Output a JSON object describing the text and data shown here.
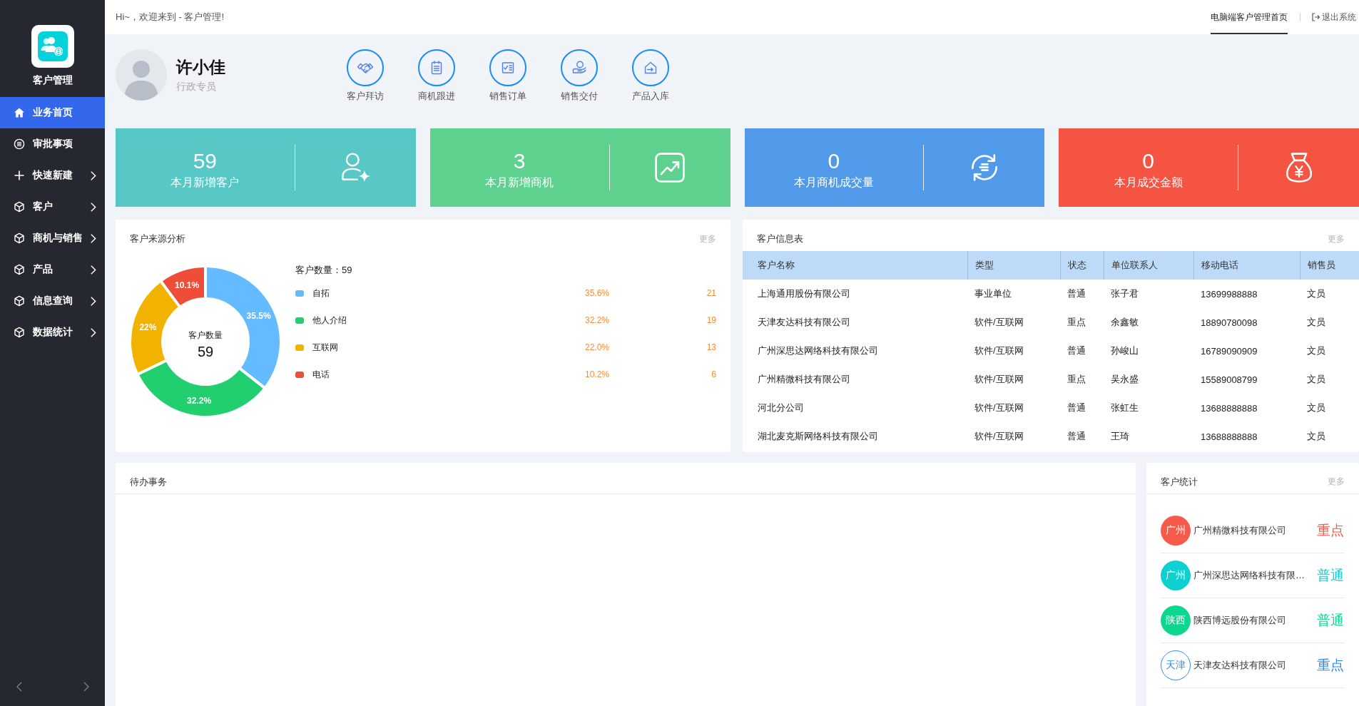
{
  "sidebar": {
    "app_name": "客户管理",
    "menu": [
      {
        "label": "业务首页",
        "kind": "link",
        "selected": true
      },
      {
        "label": "审批事项",
        "kind": "link",
        "selected": false
      },
      {
        "label": "快速新建",
        "kind": "submenu",
        "selected": false
      },
      {
        "label": "客户",
        "kind": "submenu",
        "selected": false
      },
      {
        "label": "商机与销售",
        "kind": "submenu",
        "selected": false
      },
      {
        "label": "产品",
        "kind": "submenu",
        "selected": false
      },
      {
        "label": "信息查询",
        "kind": "submenu",
        "selected": false
      },
      {
        "label": "数据统计",
        "kind": "submenu",
        "selected": false
      }
    ]
  },
  "topbar": {
    "greeting": "Hi~，欢迎来到 - 客户管理!",
    "tabs": [
      {
        "label": "电脑端客户管理首页",
        "selected": true
      }
    ],
    "logout": "退出系统"
  },
  "profile": {
    "name": "许小佳",
    "role": "行政专员"
  },
  "quick_actions": [
    "客户拜访",
    "商机跟进",
    "销售订单",
    "销售交付",
    "产品入库"
  ],
  "stats": [
    {
      "value": "59",
      "label": "本月新增客户",
      "color": "#57c8c5"
    },
    {
      "value": "3",
      "label": "本月新增商机",
      "color": "#5fd18f"
    },
    {
      "value": "0",
      "label": "本月商机成交量",
      "color": "#5199e9"
    },
    {
      "value": "0",
      "label": "本月成交金额",
      "color": "#f65443"
    }
  ],
  "source_panel": {
    "title": "客户来源分析",
    "more": "更多",
    "center_label": "客户数量",
    "center_value": "59",
    "legend_title": "客户数量：59",
    "legend": [
      {
        "color": "#65bbff",
        "percent": "35.6%",
        "count": "21"
      },
      {
        "color": "#22cf6e",
        "percent": "32.2%",
        "count": "19"
      },
      {
        "color": "#f2b300",
        "percent": "22.0%",
        "count": "13"
      },
      {
        "color": "#ee4d38",
        "percent": "10.2%",
        "count": "6"
      }
    ],
    "chart_data": {
      "type": "donut",
      "categories": [
        "自拓",
        "他人介绍",
        "互联网",
        "电话"
      ],
      "values": [
        35.5,
        32.2,
        22,
        10.1
      ],
      "value_labels": [
        "35.5%",
        "32.2%",
        "22%",
        "10.1%"
      ]
    }
  },
  "customer_table": {
    "title": "客户信息表",
    "more": "更多",
    "columns": [
      "客户名称",
      "类型",
      "状态",
      "单位联系人",
      "移动电话",
      "销售员"
    ],
    "rows": [
      [
        "上海通用股份有限公司",
        "事业单位",
        "普通",
        "张子君",
        "13699988888",
        "文员"
      ],
      [
        "天津友达科技有限公司",
        "软件/互联网",
        "重点",
        "余鑫敏",
        "18890780098",
        "文员"
      ],
      [
        "广州深思达网络科技有限公司",
        "软件/互联网",
        "普通",
        "孙峻山",
        "16789090909",
        "文员"
      ],
      [
        "广州精微科技有限公司",
        "软件/互联网",
        "重点",
        "吴永盛",
        "15589008799",
        "文员"
      ],
      [
        "河北分公司",
        "软件/互联网",
        "普通",
        "张虹生",
        "13688888888",
        "文员"
      ],
      [
        "湖北麦克斯网络科技有限公司",
        "软件/互联网",
        "普通",
        "王琦",
        "13688888888",
        "文员"
      ]
    ]
  },
  "todo_panel": {
    "title": "待办事务"
  },
  "customer_stats": {
    "title": "客户统计",
    "more": "更多",
    "items": [
      {
        "badge": "广州",
        "kind": "filled",
        "color": "#f65a4a",
        "name": "广州精微科技有限公司",
        "status": "重点"
      },
      {
        "badge": "广州",
        "kind": "filled",
        "color": "#0fd0d0",
        "name": "广州深思达网络科技有限…",
        "status": "普通"
      },
      {
        "badge": "陕西",
        "kind": "filled",
        "color": "#0dd68f",
        "name": "陕西博远股份有限公司",
        "status": "普通"
      },
      {
        "badge": "天津",
        "kind": "outline",
        "color": "#2d8cf0",
        "name": "天津友达科技有限公司",
        "status": "重点"
      }
    ]
  }
}
